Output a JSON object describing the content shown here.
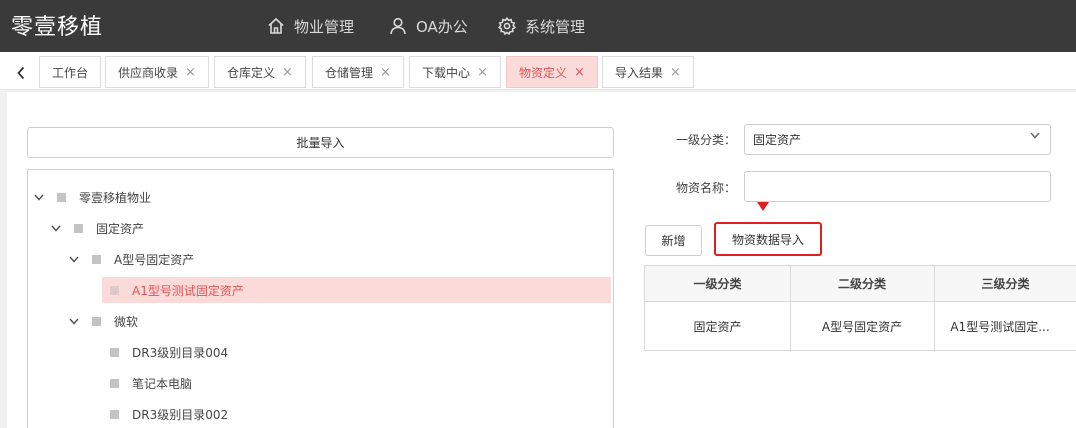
{
  "header": {
    "brand": "零壹移植",
    "nav": [
      {
        "label": "物业管理",
        "icon": "home-icon"
      },
      {
        "label": "OA办公",
        "icon": "user-icon"
      },
      {
        "label": "系统管理",
        "icon": "gear-icon"
      }
    ]
  },
  "tabs": {
    "back_icon": "chevron-left-icon",
    "items": [
      {
        "label": "工作台",
        "closable": false
      },
      {
        "label": "供应商收录",
        "closable": true
      },
      {
        "label": "仓库定义",
        "closable": true
      },
      {
        "label": "仓储管理",
        "closable": true
      },
      {
        "label": "下载中心",
        "closable": true
      },
      {
        "label": "物资定义",
        "closable": true,
        "active": true
      },
      {
        "label": "导入结果",
        "closable": true
      }
    ],
    "close_glyph": "×",
    "accent_color": "#e05555"
  },
  "left": {
    "batch_import_label": "批量导入",
    "tree": [
      {
        "label": "零壹移植物业",
        "expanded": true
      },
      {
        "label": "固定资产",
        "expanded": true
      },
      {
        "label": "A型号固定资产",
        "expanded": true
      },
      {
        "label": "A1型号测试固定资产",
        "selected": true
      },
      {
        "label": "微软",
        "expanded": true
      },
      {
        "label": "DR3级别目录004"
      },
      {
        "label": "笔记本电脑"
      },
      {
        "label": "DR3级别目录002"
      }
    ]
  },
  "right": {
    "category_label": "一级分类：",
    "category_value": "固定资产",
    "name_label": "物资名称：",
    "name_value": "",
    "add_button": "新增",
    "import_button": "物资数据导入",
    "highlight_color": "#e02020",
    "table": {
      "columns": [
        "一级分类",
        "二级分类",
        "三级分类"
      ],
      "rows": [
        [
          "固定资产",
          "A型号固定资产",
          "A1型号测试固定..."
        ]
      ]
    }
  }
}
